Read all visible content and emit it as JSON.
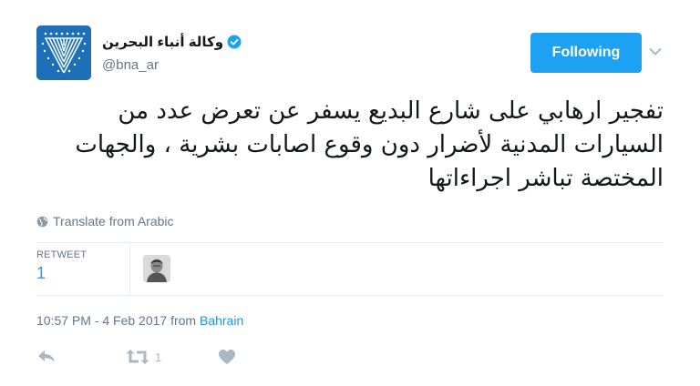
{
  "user": {
    "display_name": "وكالة أنباء البحرين",
    "handle": "@bna_ar",
    "verified": true
  },
  "header": {
    "follow_label": "Following",
    "caret_icon": "chevron-down-icon"
  },
  "tweet": {
    "text": "تفجير ارهابي على شارع البديع يسفر عن تعرض عدد من السيارات المدنية لأضرار دون وقوع اصابات بشرية ، والجهات المختصة تباشر اجراءاتها",
    "translate_label": "Translate from Arabic"
  },
  "stats": {
    "retweet_label": "RETWEET",
    "retweet_count": "1"
  },
  "meta": {
    "time": "10:57 PM - 4 Feb 2017",
    "from_label": "from",
    "location": "Bahrain"
  },
  "actions": {
    "retweet_count": "1"
  },
  "colors": {
    "accent": "#1da1f2",
    "link": "#1b95e0",
    "muted": "#657786",
    "icon": "#aab8c2",
    "avatar_bg": "#1d6fb8"
  }
}
